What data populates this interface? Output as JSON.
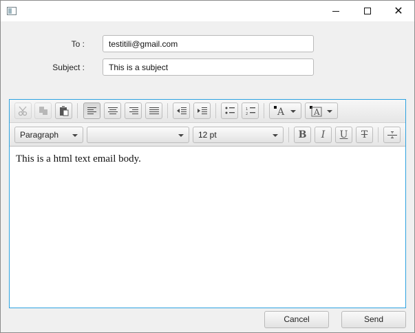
{
  "window": {
    "title": ""
  },
  "form": {
    "to_label": "To :",
    "to_value": "testitili@gmail.com",
    "subject_label": "Subject :",
    "subject_value": "This is a subject"
  },
  "toolbar": {
    "row1": [
      "cut-icon",
      "copy-icon",
      "paste-icon",
      "align-left-icon",
      "align-center-icon",
      "align-right-icon",
      "align-justify-icon",
      "outdent-icon",
      "indent-icon",
      "bullet-list-icon",
      "numbered-list-icon",
      "text-color-icon",
      "background-color-icon"
    ],
    "format_value": "Paragraph",
    "font_value": "",
    "size_value": "12 pt",
    "bold": "B",
    "italic": "I",
    "underline": "U",
    "strike": "T"
  },
  "editor": {
    "body_text": "This is a html text email body."
  },
  "buttons": {
    "cancel": "Cancel",
    "send": "Send"
  },
  "colors": {
    "accent": "#2aa1e0",
    "window_bg": "#f0f0f0"
  }
}
